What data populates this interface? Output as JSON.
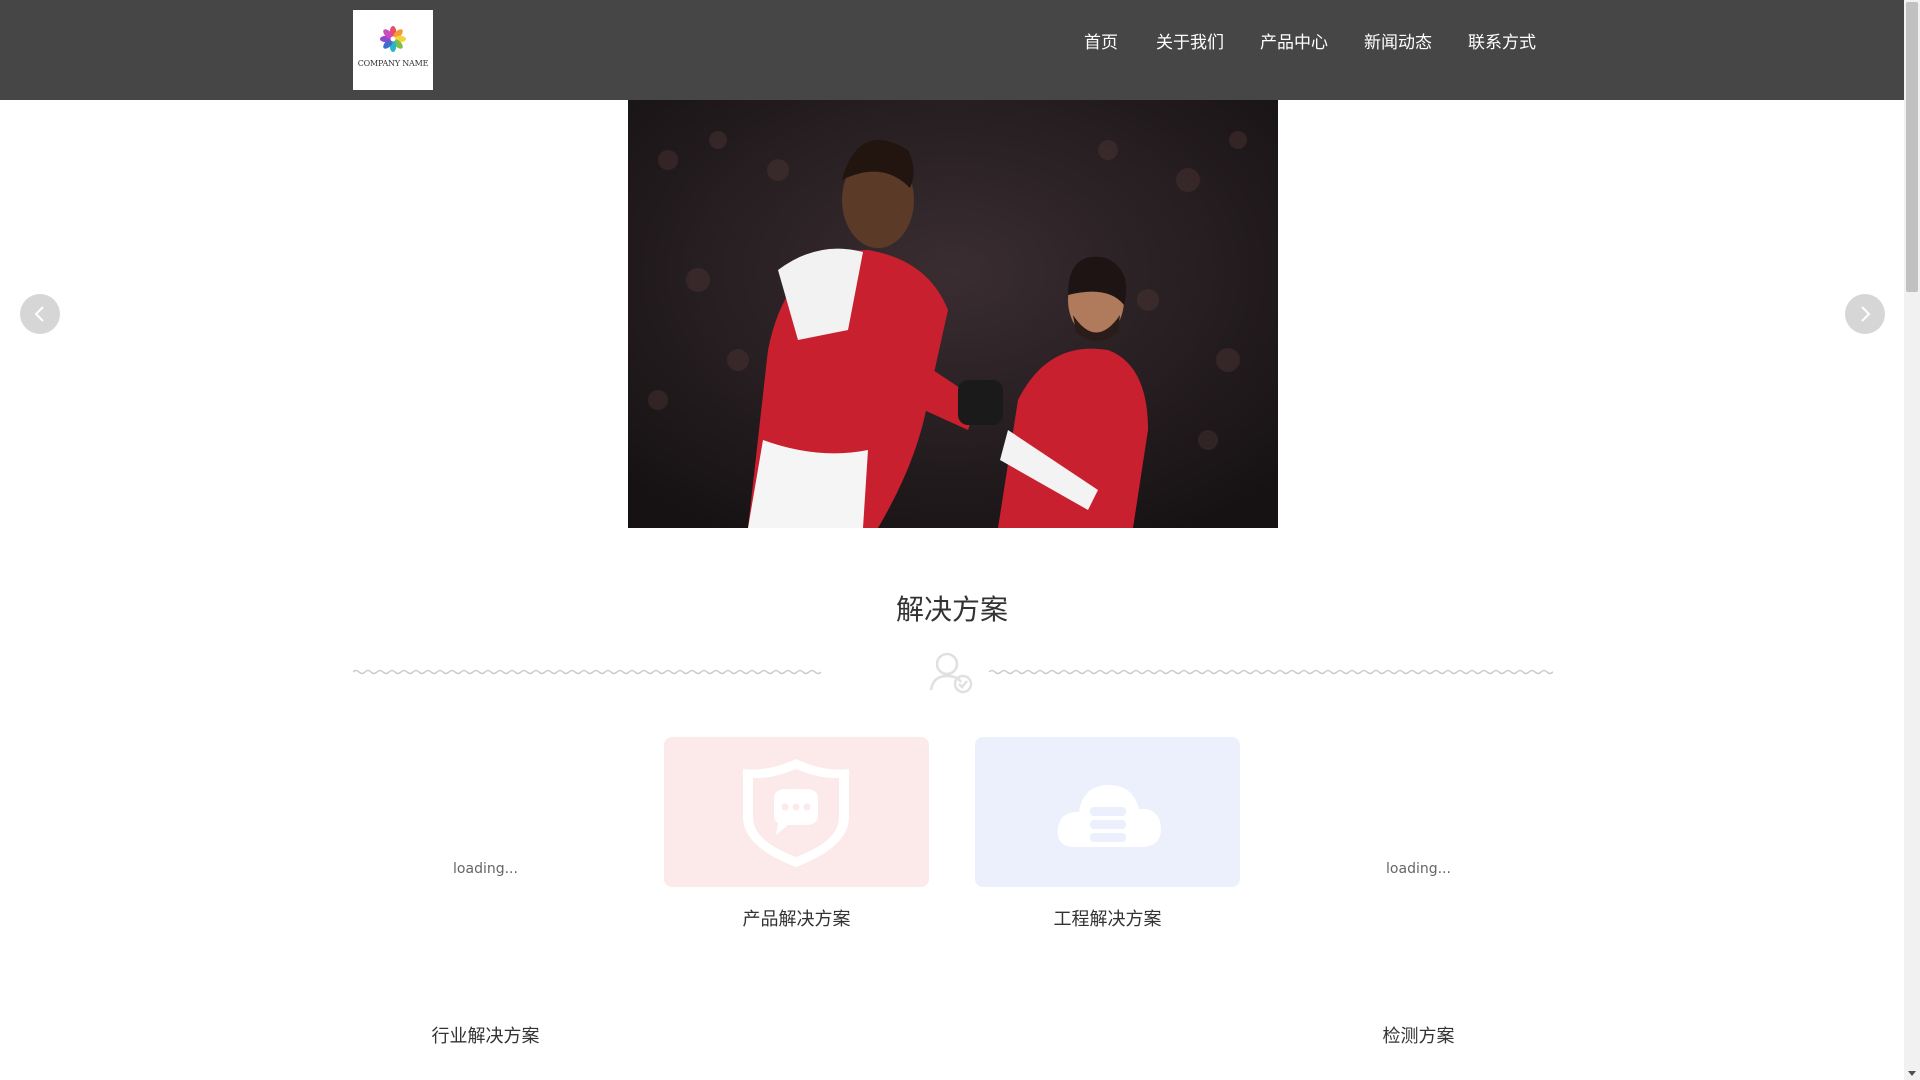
{
  "header": {
    "logo_text": "COMPANY NAME",
    "nav": [
      "首页",
      "关于我们",
      "产品中心",
      "新闻动态",
      "联系方式"
    ]
  },
  "banner": {
    "photo_description": "football-celebration-photo",
    "prev_icon": "chevron-left-icon",
    "next_icon": "chevron-right-icon"
  },
  "solutions": {
    "title": "解决方案",
    "items": [
      {
        "label": "行业解决方案",
        "status": "loading..."
      },
      {
        "label": "产品解决方案",
        "icon": "shield-chat-icon",
        "bg": "#fce9e9"
      },
      {
        "label": "工程解决方案",
        "icon": "cloud-server-icon",
        "bg": "#eceffc"
      },
      {
        "label": "检测方案",
        "status": "loading..."
      }
    ]
  },
  "colors": {
    "header_bg": "#464646",
    "nav_text": "#ffffff",
    "card_pink": "#fce9e9",
    "card_blue": "#eceffc"
  }
}
